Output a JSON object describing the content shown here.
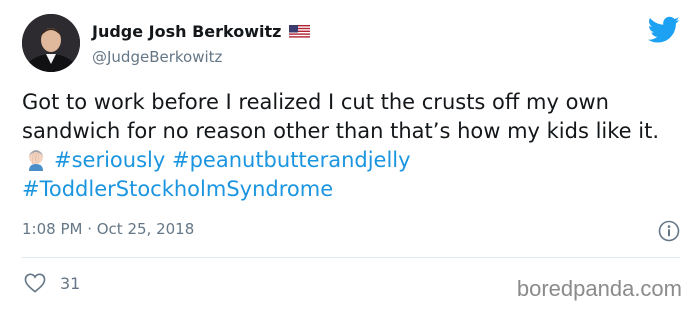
{
  "tweet": {
    "display_name": "Judge Josh Berkowitz",
    "handle": "@JudgeBerkowitz",
    "text_part1": "Got to work before I realized I cut the crusts off my own sandwich for no reason other than that’s how my kids like it.",
    "hashtags": [
      "#seriously",
      "#peanutbutterandjelly",
      "#ToddlerStockholmSyndrome"
    ],
    "timestamp": "1:08 PM · Oct 25, 2018",
    "like_count": "31"
  },
  "icons": {
    "avatar": "profile-photo",
    "flag": "us-flag-emoji",
    "brand": "twitter-bird-icon",
    "emoji": "man-facepalming-emoji",
    "info": "info-icon",
    "like": "heart-icon"
  },
  "watermark": "boredpanda.com",
  "colors": {
    "hashtag": "#1b95e0",
    "muted": "#657786",
    "text": "#14171a",
    "brand": "#1da1f2"
  }
}
